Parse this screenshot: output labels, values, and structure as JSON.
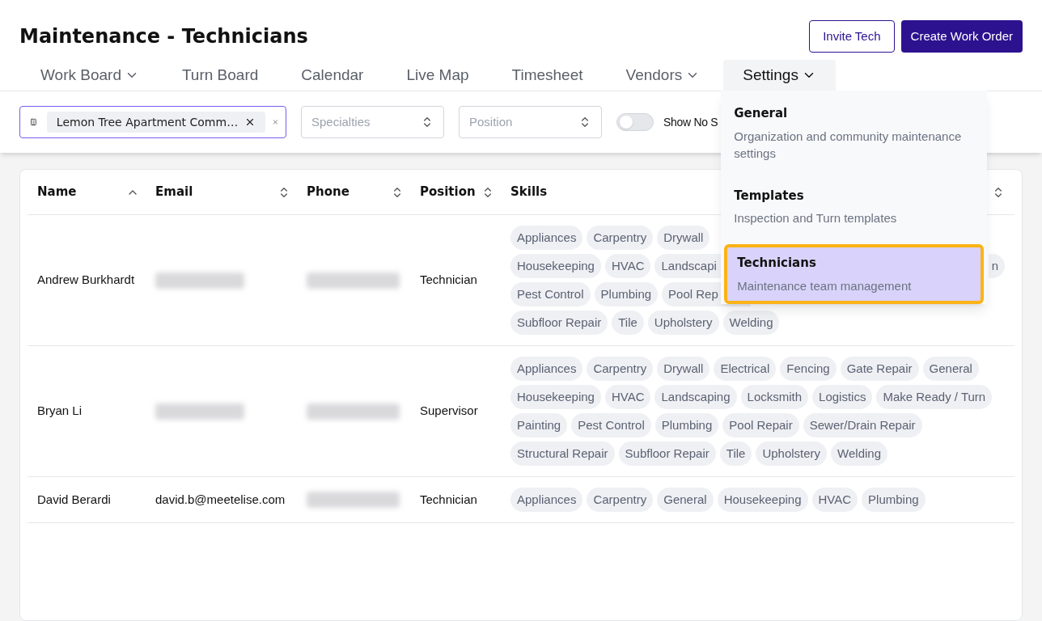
{
  "title": "Maintenance - Technicians",
  "buttons": [
    {
      "label": "Invite Tech",
      "kind": "outline"
    },
    {
      "label": "Create Work Order",
      "kind": "primary"
    }
  ],
  "tabs": [
    {
      "label": "Work Board",
      "dropdown": true,
      "selected": false
    },
    {
      "label": "Turn Board",
      "dropdown": false,
      "selected": false
    },
    {
      "label": "Calendar",
      "dropdown": false,
      "selected": false
    },
    {
      "label": "Live Map",
      "dropdown": false,
      "selected": false
    },
    {
      "label": "Timesheet",
      "dropdown": false,
      "selected": false
    },
    {
      "label": "Vendors",
      "dropdown": true,
      "selected": false
    },
    {
      "label": "Settings",
      "dropdown": true,
      "selected": true
    }
  ],
  "settings_menu": [
    {
      "title": "General",
      "description": "Organization and community maintenance settings",
      "selected": false
    },
    {
      "title": "Templates",
      "description": "Inspection and Turn templates",
      "selected": false
    },
    {
      "title": "Technicians",
      "description": "Maintenance team management",
      "selected": true
    }
  ],
  "filters": {
    "community": {
      "value": "Lemon Tree Apartment Comm…"
    },
    "specialties": {
      "placeholder": "Specialties"
    },
    "position": {
      "placeholder": "Position"
    },
    "toggle": {
      "label": "Show No S",
      "on": false
    }
  },
  "table": {
    "columns": [
      {
        "label": "Name",
        "sorted": true
      },
      {
        "label": "Email",
        "sorted": false
      },
      {
        "label": "Phone",
        "sorted": false
      },
      {
        "label": "Position",
        "sorted": false
      },
      {
        "label": "Skills",
        "sorted": false
      }
    ],
    "rows": [
      {
        "name": "Andrew Burkhardt",
        "email": {
          "redacted": true
        },
        "phone": {
          "redacted": true
        },
        "position": "Technician",
        "skill_lines": [
          [
            {
              "text": "Appliances",
              "kind": "whole"
            },
            {
              "text": "Carpentry",
              "kind": "whole"
            },
            {
              "text": "Drywall",
              "kind": "whole"
            }
          ],
          [
            {
              "text": "Housekeeping",
              "kind": "whole"
            },
            {
              "text": "HVAC",
              "kind": "whole"
            },
            {
              "text": "Landscapi",
              "kind": "cut"
            },
            {
              "text": "n",
              "kind": "tail"
            }
          ],
          [
            {
              "text": "Pest Control",
              "kind": "whole"
            },
            {
              "text": "Plumbing",
              "kind": "whole"
            },
            {
              "text": "Pool Rep",
              "kind": "cut"
            }
          ],
          [
            {
              "text": "Subfloor Repair",
              "kind": "whole"
            },
            {
              "text": "Tile",
              "kind": "whole"
            },
            {
              "text": "Upholstery",
              "kind": "whole"
            },
            {
              "text": "Welding",
              "kind": "whole"
            }
          ]
        ]
      },
      {
        "name": "Bryan Li",
        "email": {
          "redacted": true
        },
        "phone": {
          "redacted": true
        },
        "position": "Supervisor",
        "skill_lines": [
          [
            {
              "text": "Appliances",
              "kind": "whole"
            },
            {
              "text": "Carpentry",
              "kind": "whole"
            },
            {
              "text": "Drywall",
              "kind": "whole"
            },
            {
              "text": "Electrical",
              "kind": "whole"
            },
            {
              "text": "Fencing",
              "kind": "whole"
            },
            {
              "text": "Gate Repair",
              "kind": "whole"
            },
            {
              "text": "General",
              "kind": "whole"
            }
          ],
          [
            {
              "text": "Housekeeping",
              "kind": "whole"
            },
            {
              "text": "HVAC",
              "kind": "whole"
            },
            {
              "text": "Landscaping",
              "kind": "whole"
            },
            {
              "text": "Locksmith",
              "kind": "whole"
            },
            {
              "text": "Logistics",
              "kind": "whole"
            },
            {
              "text": "Make Ready / Turn",
              "kind": "whole"
            }
          ],
          [
            {
              "text": "Painting",
              "kind": "whole"
            },
            {
              "text": "Pest Control",
              "kind": "whole"
            },
            {
              "text": "Plumbing",
              "kind": "whole"
            },
            {
              "text": "Pool Repair",
              "kind": "whole"
            },
            {
              "text": "Sewer/Drain Repair",
              "kind": "whole"
            }
          ],
          [
            {
              "text": "Structural Repair",
              "kind": "whole"
            },
            {
              "text": "Subfloor Repair",
              "kind": "whole"
            },
            {
              "text": "Tile",
              "kind": "whole"
            },
            {
              "text": "Upholstery",
              "kind": "whole"
            },
            {
              "text": "Welding",
              "kind": "whole"
            }
          ]
        ]
      },
      {
        "name": "David Berardi",
        "email": {
          "redacted": false,
          "text": "david.b@meetelise.com"
        },
        "phone": {
          "redacted": true
        },
        "position": "Technician",
        "skill_lines": [
          [
            {
              "text": "Appliances",
              "kind": "whole"
            },
            {
              "text": "Carpentry",
              "kind": "whole"
            },
            {
              "text": "General",
              "kind": "whole"
            },
            {
              "text": "Housekeeping",
              "kind": "whole"
            },
            {
              "text": "HVAC",
              "kind": "whole"
            },
            {
              "text": "Plumbing",
              "kind": "whole"
            }
          ]
        ]
      }
    ]
  }
}
